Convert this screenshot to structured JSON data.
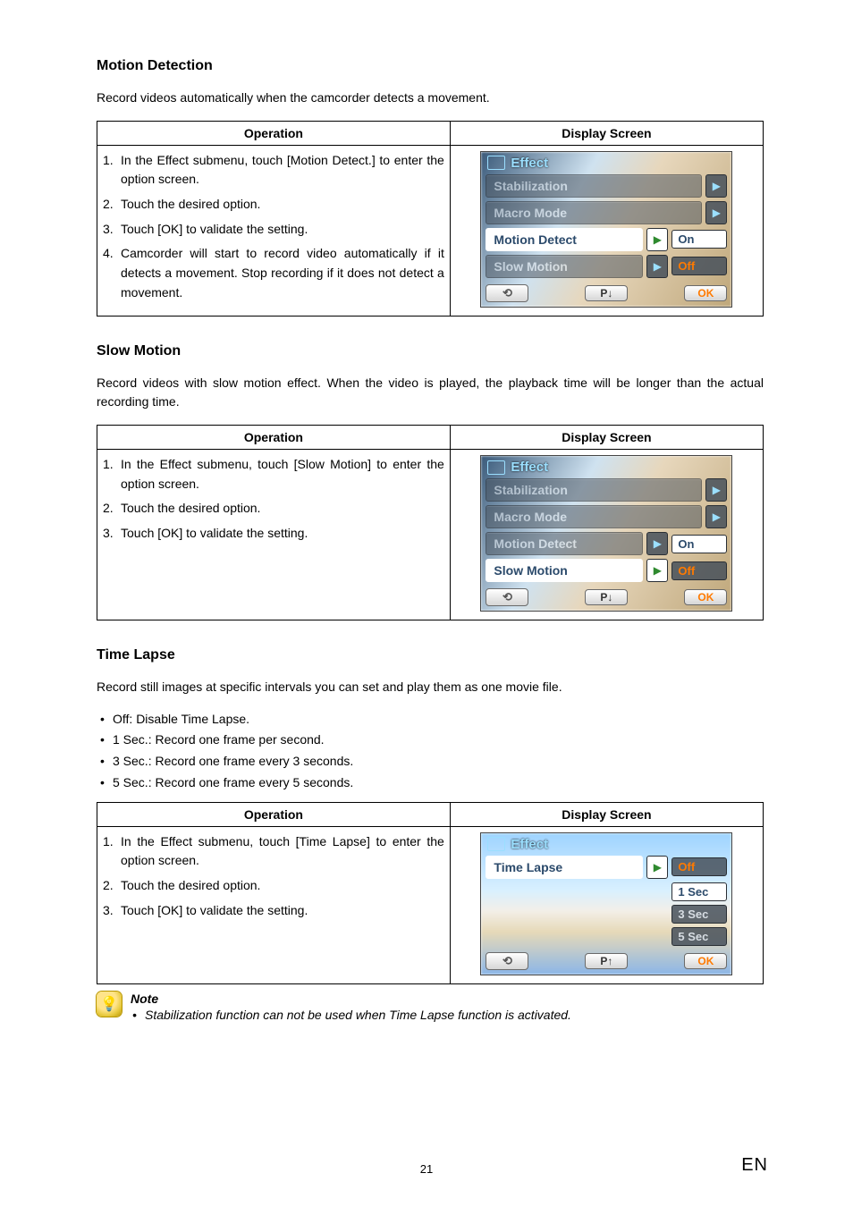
{
  "sections": {
    "motion": {
      "title": "Motion Detection",
      "lead": "Record videos automatically when the camcorder detects a movement.",
      "table": {
        "op_header": "Operation",
        "ds_header": "Display Screen",
        "steps": [
          "In the Effect submenu, touch [Motion Detect.] to enter the option screen.",
          "Touch the desired option.",
          "Touch [OK] to validate the setting.",
          "Camcorder will start to record video automatically if it detects a movement. Stop recording if it does not detect a movement."
        ],
        "screen": {
          "header": "Effect",
          "items": [
            "Stabilization",
            "Macro Mode",
            "Motion Detect",
            "Slow Motion"
          ],
          "selected_index": 2,
          "options": [
            "On",
            "Off"
          ],
          "selected_option_index": 0,
          "back_label": "↩",
          "page_label": "P↓",
          "ok_label": "OK"
        }
      }
    },
    "slow": {
      "title": "Slow Motion",
      "lead": "Record videos with slow motion effect. When the video is played, the playback time will be longer than the actual recording time.",
      "table": {
        "op_header": "Operation",
        "ds_header": "Display Screen",
        "steps": [
          "In the Effect submenu, touch [Slow Motion] to enter the option screen.",
          "Touch the desired option.",
          "Touch [OK] to validate the setting."
        ],
        "screen": {
          "header": "Effect",
          "items": [
            "Stabilization",
            "Macro Mode",
            "Motion Detect",
            "Slow Motion"
          ],
          "selected_index": 3,
          "options": [
            "On",
            "Off"
          ],
          "selected_option_index": 0,
          "back_label": "↩",
          "page_label": "P↓",
          "ok_label": "OK"
        }
      }
    },
    "timelapse": {
      "title": "Time Lapse",
      "lead": "Record still images at specific intervals you can set and play them as one movie file.",
      "bullets": [
        "Off: Disable Time Lapse.",
        "1 Sec.: Record one frame per second.",
        "3 Sec.: Record one frame every 3 seconds.",
        "5 Sec.: Record one frame every 5 seconds."
      ],
      "table": {
        "op_header": "Operation",
        "ds_header": "Display Screen",
        "steps": [
          "In the Effect submenu, touch [Time Lapse] to enter the option screen.",
          "Touch the desired option.",
          "Touch [OK] to validate the setting."
        ],
        "screen": {
          "header": "Effect",
          "title_item": "Time Lapse",
          "options": [
            "Off",
            "1 Sec",
            "3 Sec",
            "5 Sec"
          ],
          "selected_option_index": 0,
          "back_label": "↩",
          "page_label": "P↑",
          "ok_label": "OK"
        }
      }
    }
  },
  "note": {
    "head": "Note",
    "items": [
      "Stabilization function can not be used when Time Lapse function is activated."
    ]
  },
  "footer": {
    "page": "21",
    "lang": "EN"
  }
}
